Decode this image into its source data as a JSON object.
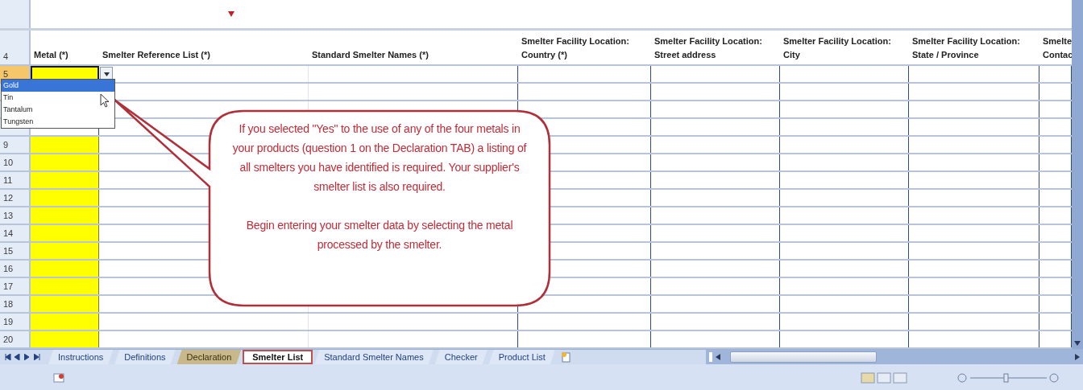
{
  "header_row": {
    "number": "4"
  },
  "columns": [
    {
      "lines": [
        "Metal (*)"
      ]
    },
    {
      "lines": [
        "Smelter Reference List (*)"
      ]
    },
    {
      "lines": [
        "Standard Smelter Names (*)"
      ]
    },
    {
      "lines": [
        "Smelter Facility Location:",
        "Country (*)"
      ]
    },
    {
      "lines": [
        "Smelter Facility Location:",
        "Street address"
      ]
    },
    {
      "lines": [
        "Smelter Facility Location:",
        "City"
      ]
    },
    {
      "lines": [
        "Smelter Facility Location:",
        "State / Province"
      ]
    },
    {
      "lines": [
        "Smelte",
        "Contac"
      ]
    }
  ],
  "rows": [
    {
      "number": "5",
      "selected": true
    },
    {
      "number": "9",
      "selected": false
    },
    {
      "number": "10",
      "selected": false
    },
    {
      "number": "11",
      "selected": false
    },
    {
      "number": "12",
      "selected": false
    },
    {
      "number": "13",
      "selected": false
    },
    {
      "number": "14",
      "selected": false
    },
    {
      "number": "15",
      "selected": false
    },
    {
      "number": "16",
      "selected": false
    },
    {
      "number": "17",
      "selected": false
    },
    {
      "number": "18",
      "selected": false
    },
    {
      "number": "19",
      "selected": false
    },
    {
      "number": "20",
      "selected": false
    }
  ],
  "dropdown": {
    "options": [
      {
        "label": "Gold",
        "selected": true
      },
      {
        "label": "Tin",
        "selected": false
      },
      {
        "label": "Tantalum",
        "selected": false
      },
      {
        "label": "Tungsten",
        "selected": false
      }
    ]
  },
  "callout": {
    "paragraphs": [
      "If you selected \"Yes\" to the use of any of the four metals in  your products (question 1 on the Declaration TAB) a listing of all smelters you have identified is required.  Your supplier's smelter list is also required.",
      "Begin entering your smelter data by selecting the metal processed by the smelter."
    ]
  },
  "sheet_tabs": [
    {
      "label": "Instructions",
      "selected": false
    },
    {
      "label": "Definitions",
      "selected": false
    },
    {
      "label": "Declaration",
      "selected": false,
      "color": "#c9b98a"
    },
    {
      "label": "Smelter List",
      "selected": true
    },
    {
      "label": "Standard Smelter Names",
      "selected": false
    },
    {
      "label": "Checker",
      "selected": false
    },
    {
      "label": "Product List",
      "selected": false
    }
  ]
}
